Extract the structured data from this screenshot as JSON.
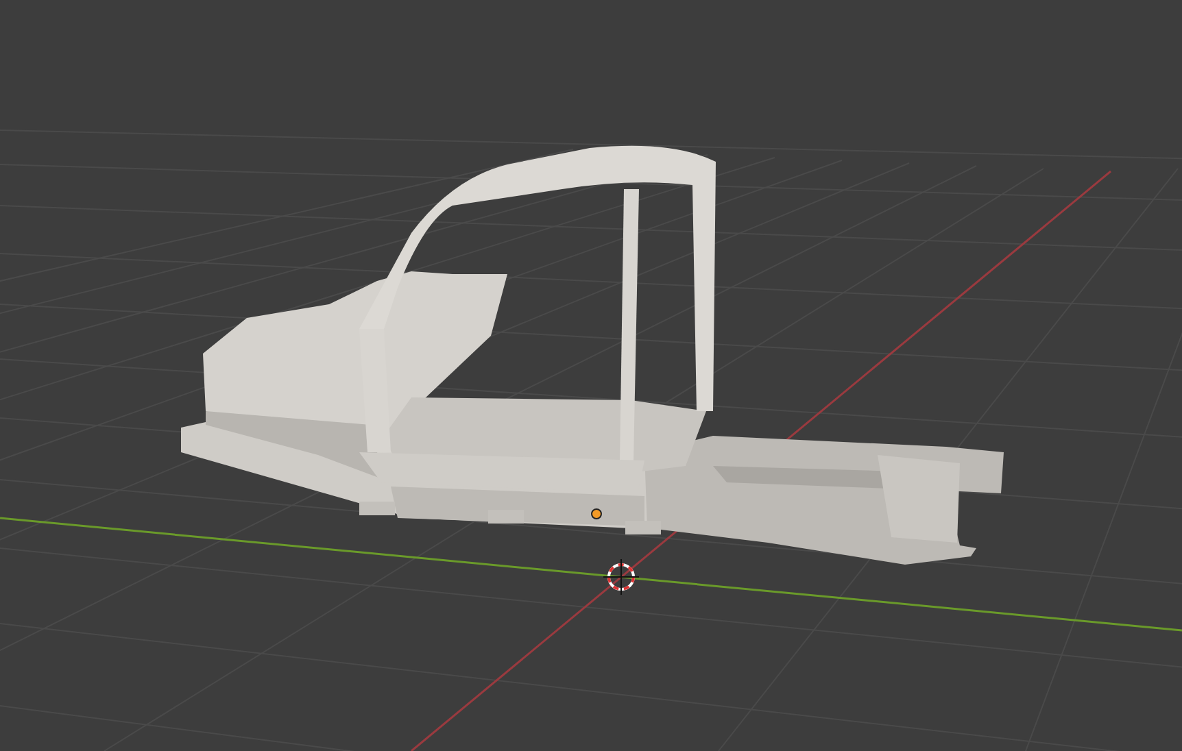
{
  "viewport": {
    "show_floor_grid": true,
    "show_x_axis": true,
    "show_y_axis": true,
    "show_3d_cursor": true,
    "show_origin": true
  }
}
